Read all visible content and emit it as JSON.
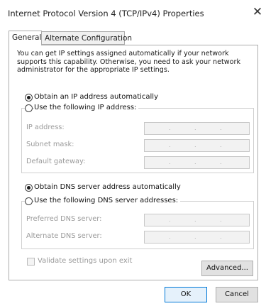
{
  "window": {
    "title": "Internet Protocol Version 4 (TCP/IPv4) Properties",
    "close_glyph": "✕"
  },
  "tabs": [
    {
      "label": "General",
      "active": true
    },
    {
      "label": "Alternate Configuration",
      "active": false
    }
  ],
  "description": "You can get IP settings assigned automatically if your network supports this capability. Otherwise, you need to ask your network administrator for the appropriate IP settings.",
  "ip_section": {
    "auto_label": "Obtain an IP address automatically",
    "auto_selected": true,
    "manual_label": "Use the following IP address:",
    "fields": [
      {
        "label": "IP address:"
      },
      {
        "label": "Subnet mask:"
      },
      {
        "label": "Default gateway:"
      }
    ]
  },
  "dns_section": {
    "auto_label": "Obtain DNS server address automatically",
    "auto_selected": true,
    "manual_label": "Use the following DNS server addresses:",
    "fields": [
      {
        "label": "Preferred DNS server:"
      },
      {
        "label": "Alternate DNS server:"
      }
    ]
  },
  "ip_dot": ".",
  "validate": {
    "label": "Validate settings upon exit",
    "checked": false
  },
  "buttons": {
    "advanced": "Advanced...",
    "ok": "OK",
    "cancel": "Cancel"
  }
}
